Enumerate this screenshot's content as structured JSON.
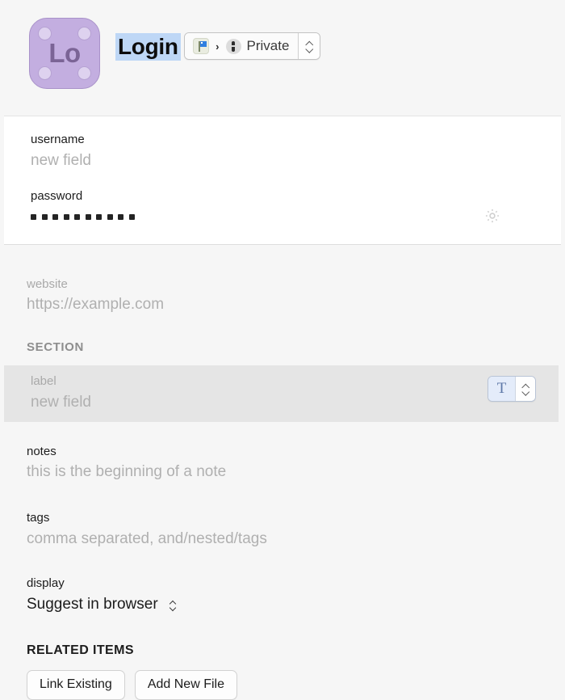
{
  "header": {
    "icon_text": "Lo",
    "icon_name": "login-item-icon",
    "title": "Login",
    "vault": {
      "flag_icon": "flag-icon",
      "separator": "›",
      "badge_icon": "key-icon",
      "name": "Private"
    }
  },
  "credentials": {
    "username": {
      "label": "username",
      "value": "new field"
    },
    "password": {
      "label": "password",
      "value": "••••••••••",
      "dot_count": 10,
      "gear_icon": "gear-icon"
    }
  },
  "website": {
    "label": "website",
    "value": "https://example.com"
  },
  "section": {
    "title": "SECTION",
    "label_field": {
      "label": "label",
      "value": "new field",
      "type_glyph": "T"
    },
    "notes": {
      "label": "notes",
      "value": "this is the beginning of a note"
    },
    "tags": {
      "label": "tags",
      "value": "comma separated, and/nested/tags"
    },
    "display": {
      "label": "display",
      "value": "Suggest in browser"
    }
  },
  "related": {
    "title": "RELATED ITEMS",
    "link_existing": "Link Existing",
    "add_new_file": "Add New File"
  },
  "colors": {
    "icon_fill": "#c3aee0",
    "selection": "#bed7f6",
    "row_highlight": "#e5e5e5",
    "type_accent": "#5f79a8"
  }
}
